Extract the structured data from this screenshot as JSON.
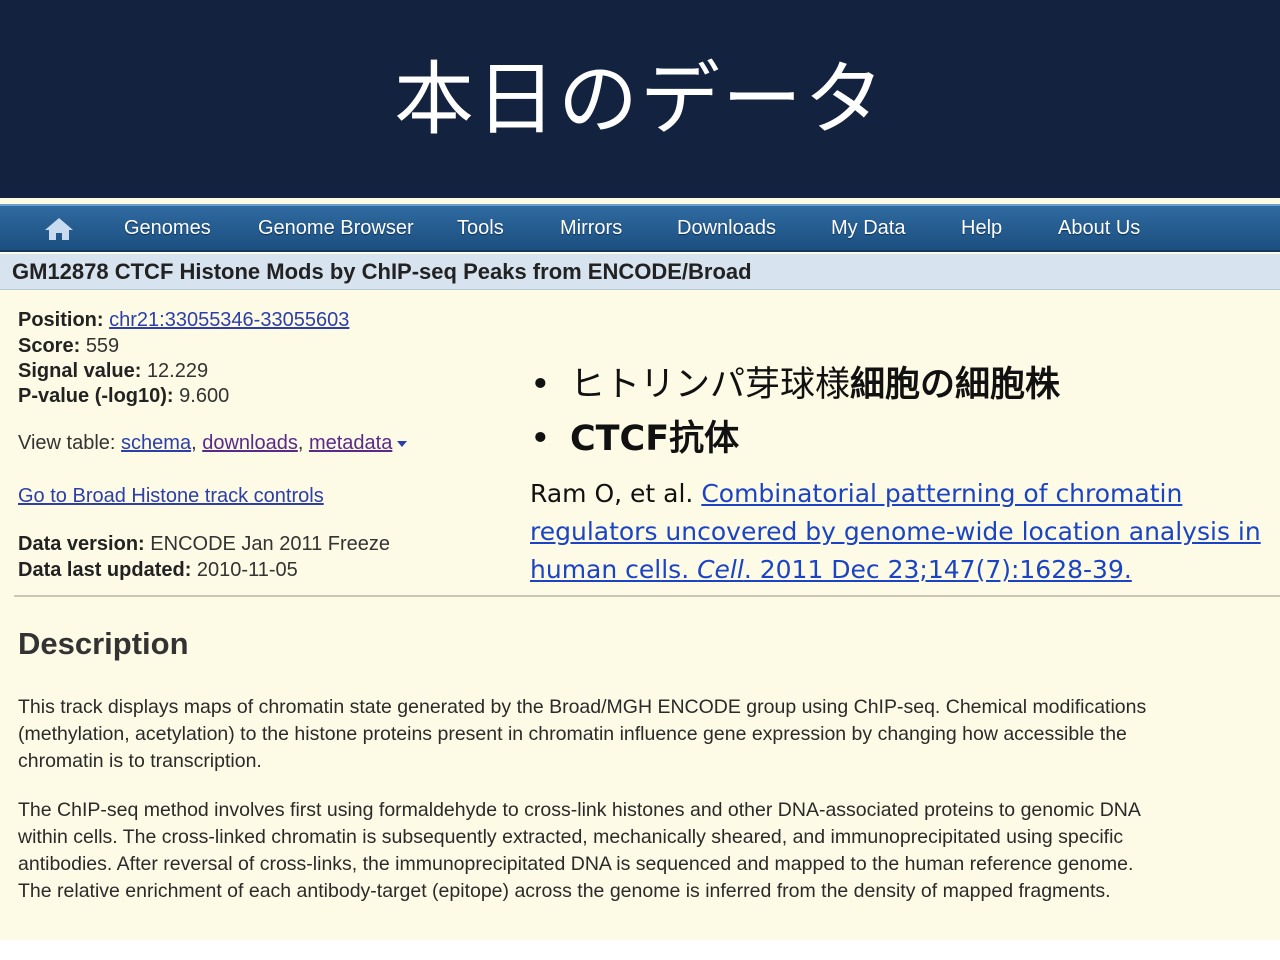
{
  "slide": {
    "title": "本日のデータ"
  },
  "navbar": {
    "home_icon": "home-icon",
    "items": [
      "Genomes",
      "Genome Browser",
      "Tools",
      "Mirrors",
      "Downloads",
      "My Data",
      "Help",
      "About Us"
    ]
  },
  "track": {
    "title": "GM12878 CTCF Histone Mods by ChIP-seq Peaks from ENCODE/Broad",
    "position_label": "Position:",
    "position_value": "chr21:33055346-33055603",
    "score_label": "Score:",
    "score_value": "559",
    "signal_label": "Signal value:",
    "signal_value": "12.229",
    "pvalue_label": "P-value (-log10):",
    "pvalue_value": "9.600",
    "view_table_label": "View table:",
    "view_table_links": [
      "schema",
      "downloads",
      "metadata"
    ],
    "controls_link": "Go to Broad Histone track controls",
    "data_version_label": "Data version:",
    "data_version_value": "ENCODE Jan 2011 Freeze",
    "last_updated_label": "Data last updated:",
    "last_updated_value": "2010-11-05"
  },
  "description": {
    "heading": "Description",
    "paragraphs": [
      "This track displays maps of chromatin state generated by the Broad/MGH ENCODE group using ChIP-seq. Chemical modifications (methylation, acetylation) to the histone proteins present in chromatin influence gene expression by changing how accessible the chromatin is to transcription.",
      "The ChIP-seq method involves first using formaldehyde to cross-link histones and other DNA-associated proteins to genomic DNA within cells. The cross-linked chromatin is subsequently extracted, mechanically sheared, and immunoprecipitated using specific antibodies. After reversal of cross-links, the immunoprecipitated DNA is sequenced and mapped to the human reference genome. The relative enrichment of each antibody-target (epitope) across the genome is inferred from the density of mapped fragments."
    ]
  },
  "overlay": {
    "bullet1_plain": "ヒトリンパ芽球様",
    "bullet1_bold": "細胞の細胞株",
    "bullet2": "CTCF抗体",
    "citation_prefix": "Ram O, et al. ",
    "citation_link_1": "Combinatorial patterning of chromatin",
    "citation_link_2": "regulators uncovered by genome-wide location analysis in",
    "citation_link_3a": "human cells. ",
    "citation_journal": "Cell",
    "citation_link_3b": ". 2011 Dec 23;147(7):1628-39."
  }
}
